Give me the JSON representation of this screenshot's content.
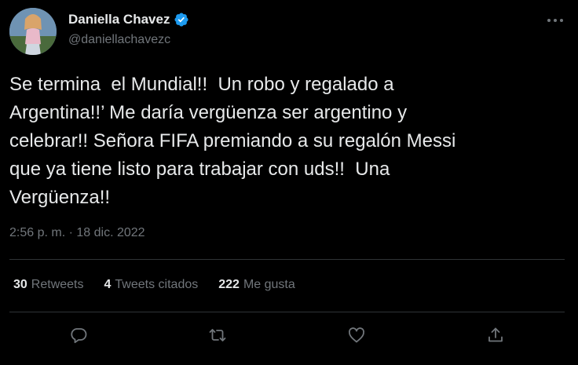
{
  "author": {
    "display_name": "Daniella Chavez",
    "handle": "@daniellachavezc",
    "verified_icon": "verified-badge-icon",
    "avatar": "profile-photo"
  },
  "tweet": {
    "text": "Se termina  el Mundial!!  Un robo y regalado a\nArgentina!!’ Me daría vergüenza ser argentino y\ncelebrar!! Señora FIFA premiando a su regalón Messi\nque ya tiene listo para trabajar con uds!!  Una\nVergüenza!!",
    "timestamp": "2:56 p. m. · 18 dic. 2022"
  },
  "stats": {
    "retweets": {
      "count": "30",
      "label": "Retweets"
    },
    "quotes": {
      "count": "4",
      "label": "Tweets citados"
    },
    "likes": {
      "count": "222",
      "label": "Me gusta"
    }
  },
  "actions": [
    {
      "icon": "reply-icon"
    },
    {
      "icon": "retweet-icon"
    },
    {
      "icon": "like-icon"
    },
    {
      "icon": "share-icon"
    }
  ],
  "colors": {
    "background": "#000000",
    "primary_text": "#e7e9ea",
    "secondary_text": "#71767b",
    "divider": "#2f3336",
    "verified": "#1d9bf0"
  }
}
